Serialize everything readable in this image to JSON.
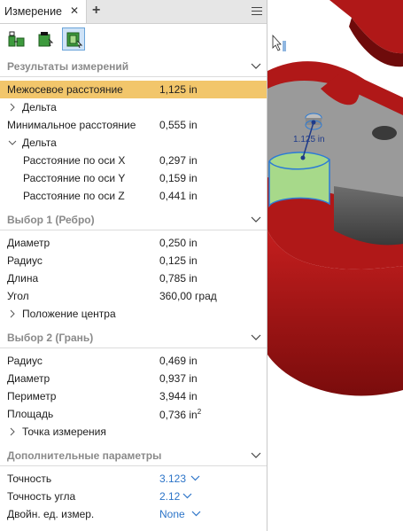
{
  "tab": {
    "title": "Измерение",
    "close_glyph": "✕",
    "add_glyph": "+"
  },
  "toolbar": {
    "tools": [
      "measure-tool-icon",
      "measure-loop-icon",
      "measure-area-icon"
    ],
    "active_index": 2
  },
  "results": {
    "header": "Результаты измерений",
    "center_distance": {
      "label": "Межосевое расстояние",
      "value": "1,125 in"
    },
    "delta_collapsed": "Дельта",
    "min_distance": {
      "label": "Минимальное расстояние",
      "value": "0,555 in"
    },
    "delta_expanded": "Дельта",
    "dx": {
      "label": "Расстояние по оси X",
      "value": "0,297 in"
    },
    "dy": {
      "label": "Расстояние по оси Y",
      "value": "0,159 in"
    },
    "dz": {
      "label": "Расстояние по оси Z",
      "value": "0,441 in"
    }
  },
  "selection1": {
    "header": "Выбор 1 (Ребро)",
    "diameter": {
      "label": "Диаметр",
      "value": "0,250 in"
    },
    "radius": {
      "label": "Радиус",
      "value": "0,125 in"
    },
    "length": {
      "label": "Длина",
      "value": "0,785 in"
    },
    "angle": {
      "label": "Угол",
      "value": "360,00 град"
    },
    "center_position": "Положение центра"
  },
  "selection2": {
    "header": "Выбор 2 (Грань)",
    "radius": {
      "label": "Радиус",
      "value": "0,469 in"
    },
    "diameter": {
      "label": "Диаметр",
      "value": "0,937 in"
    },
    "perimeter": {
      "label": "Периметр",
      "value": "3,944 in"
    },
    "area": {
      "label": "Площадь",
      "value": "0,736 in",
      "unit_sup": "2"
    },
    "measure_point": "Точка измерения"
  },
  "extra": {
    "header": "Дополнительные параметры",
    "precision": {
      "label": "Точность",
      "value": "3.123"
    },
    "angle_precision": {
      "label": "Точность угла",
      "value": "2.12"
    },
    "dual_units": {
      "label": "Двойн. ед. измер.",
      "value": "None"
    }
  },
  "viewport": {
    "dimension_label": "1.125 in"
  },
  "colors": {
    "selected_row": "#f2c66b",
    "link": "#2c74c8",
    "part_red": "#b01818",
    "part_grey": "#9a9a9a",
    "face_green": "#a7d98a"
  }
}
